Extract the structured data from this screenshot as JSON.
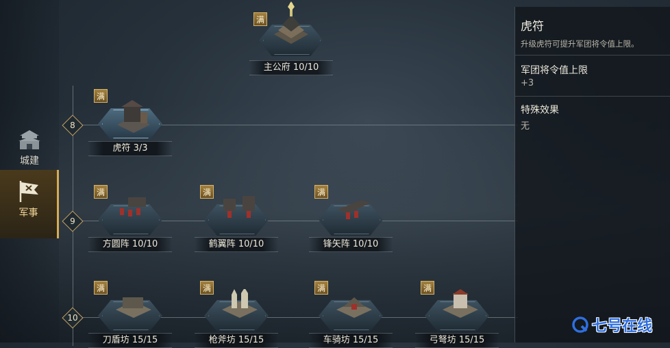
{
  "sidebar": {
    "items": [
      {
        "label": "城建",
        "icon": "city-gate-icon"
      },
      {
        "label": "军事",
        "icon": "war-flag-icon",
        "selected": true
      }
    ]
  },
  "top_building": {
    "name": "主公府",
    "level": "10/10",
    "full": "满"
  },
  "tiers": [
    {
      "number": "8",
      "buildings": [
        {
          "name": "虎符",
          "level": "3/3",
          "full": "满"
        }
      ]
    },
    {
      "number": "9",
      "buildings": [
        {
          "name": "方圆阵",
          "level": "10/10",
          "full": "满"
        },
        {
          "name": "鹤翼阵",
          "level": "10/10",
          "full": "满"
        },
        {
          "name": "锋矢阵",
          "level": "10/10",
          "full": "满"
        }
      ]
    },
    {
      "number": "10",
      "buildings": [
        {
          "name": "刀盾坊",
          "level": "15/15",
          "full": "满"
        },
        {
          "name": "枪斧坊",
          "level": "15/15",
          "full": "满"
        },
        {
          "name": "车骑坊",
          "level": "15/15",
          "full": "满"
        },
        {
          "name": "弓弩坊",
          "level": "15/15",
          "full": "满"
        }
      ]
    }
  ],
  "detail_panel": {
    "title": "虎符",
    "description": "升级虎符可提升军团将令值上限。",
    "sections": [
      {
        "heading": "军团将令值上限",
        "value": "+3"
      },
      {
        "heading": "特殊效果",
        "value": "无"
      }
    ]
  },
  "watermark": {
    "text": "七号在线",
    "color": "#2f6fe0"
  },
  "colors": {
    "accent_gold": "#d7ad55",
    "panel_bg": "#11171c"
  }
}
